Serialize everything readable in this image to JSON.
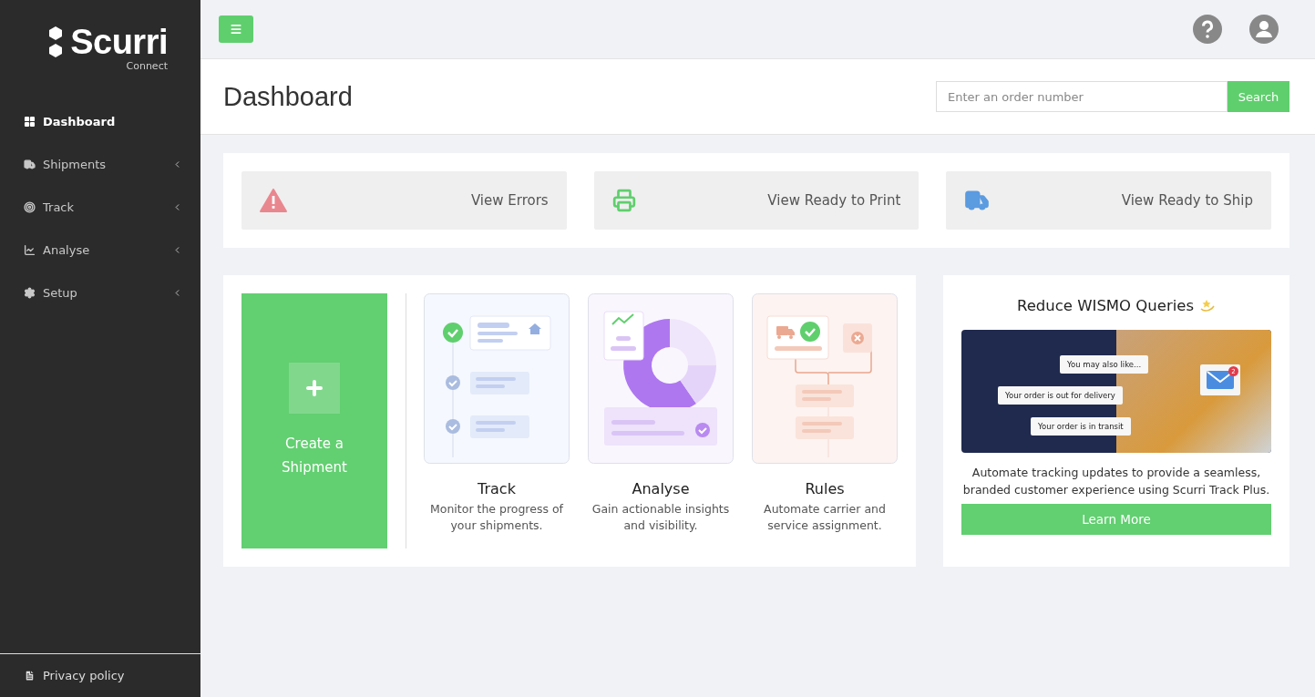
{
  "sidebar": {
    "logo": "Scurri",
    "logo_sub": "Connect",
    "items": [
      {
        "kind": "dashboard",
        "label": "Dashboard",
        "selected": true,
        "expandable": false
      },
      {
        "kind": "shipments",
        "label": "Shipments",
        "selected": false,
        "expandable": true
      },
      {
        "kind": "track",
        "label": "Track",
        "selected": false,
        "expandable": true
      },
      {
        "kind": "analyse",
        "label": "Analyse",
        "selected": false,
        "expandable": true
      },
      {
        "kind": "setup",
        "label": "Setup",
        "selected": false,
        "expandable": true
      }
    ],
    "footer": "Privacy policy"
  },
  "header": {
    "title": "Dashboard",
    "search": {
      "placeholder": "Enter an order number",
      "button": "Search"
    }
  },
  "quick_actions": [
    {
      "kind": "errors",
      "label": "View Errors"
    },
    {
      "kind": "print",
      "label": "View Ready to Print"
    },
    {
      "kind": "ship",
      "label": "View Ready to Ship"
    }
  ],
  "create": {
    "label": "Create a Shipment"
  },
  "features": [
    {
      "kind": "track",
      "title": "Track",
      "description": "Monitor the progress of your shipments."
    },
    {
      "kind": "analyse",
      "title": "Analyse",
      "description": "Gain actionable insights and visibility."
    },
    {
      "kind": "rules",
      "title": "Rules",
      "description": "Automate carrier and service assignment."
    }
  ],
  "promo": {
    "title": "Reduce WISMO Queries",
    "bubbles": [
      "You may also like...",
      "Your order is out for delivery",
      "Your order is in transit"
    ],
    "badge": "2",
    "text": "Automate tracking updates to provide a seamless, branded customer experience using Scurri Track Plus.",
    "button": "Learn More"
  }
}
